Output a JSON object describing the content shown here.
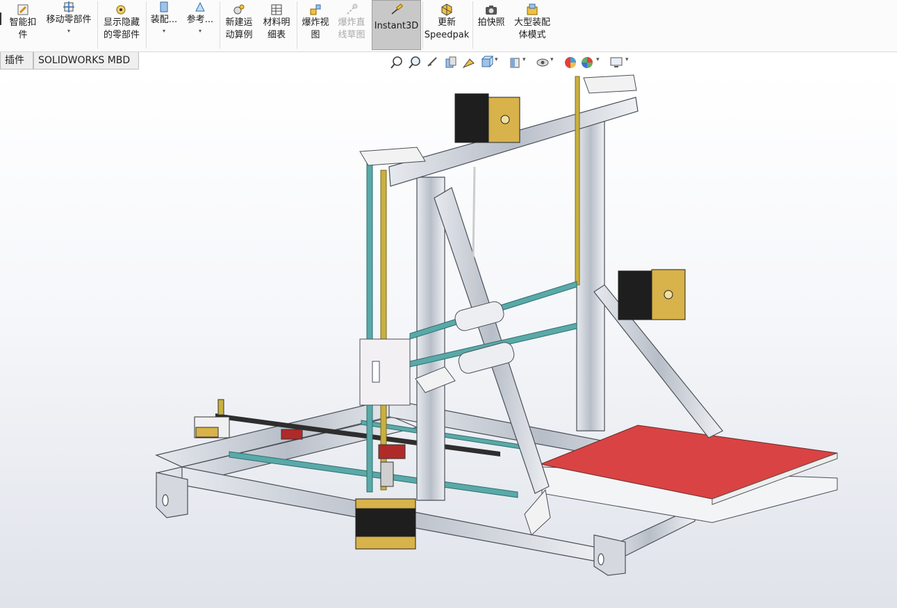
{
  "ribbon": {
    "buttons": [
      {
        "label": "智能扣\n件",
        "icon": "smart-fastener-icon"
      },
      {
        "label": "移动零部件",
        "icon": "move-component-icon",
        "dropdown": "▾"
      },
      {
        "label": "显示隐藏\n的零部件",
        "icon": "show-hidden-icon"
      },
      {
        "label": "装配...",
        "icon": "assembly-features-icon",
        "dropdown": "▾"
      },
      {
        "label": "参考...",
        "icon": "reference-geometry-icon",
        "dropdown": "▾"
      },
      {
        "label": "新建运\n动算例",
        "icon": "new-motion-study-icon"
      },
      {
        "label": "材料明\n细表",
        "icon": "bill-of-materials-icon"
      },
      {
        "label": "爆炸视\n图",
        "icon": "exploded-view-icon"
      },
      {
        "label": "爆炸直\n线草图",
        "icon": "explode-line-sketch-icon",
        "disabled": true
      },
      {
        "label": "Instant3D",
        "icon": "instant3d-icon",
        "active": true
      },
      {
        "label": "更新\nSpeedpak",
        "icon": "update-speedpak-icon"
      },
      {
        "label": "拍快照",
        "icon": "snapshot-icon"
      },
      {
        "label": "大型装配\n体模式",
        "icon": "large-assembly-icon"
      }
    ]
  },
  "tabs": [
    {
      "label": "插件"
    },
    {
      "label": "SOLIDWORKS MBD"
    }
  ],
  "view_toolbar": [
    "zoom-to-fit-icon",
    "zoom-to-area-icon",
    "previous-view-icon",
    "section-view-icon",
    "dynamic-annotation-icon",
    "view-orientation-icon",
    "display-style-icon",
    "hide-show-items-icon",
    "edit-appearance-icon",
    "apply-scene-icon",
    "view-settings-icon"
  ],
  "colors": {
    "accent": "#d9a600",
    "aluminum": "#c9ced6",
    "rod": "#4fa3a3",
    "bed": "#e04040",
    "motor_cap": "#d8b24a"
  }
}
